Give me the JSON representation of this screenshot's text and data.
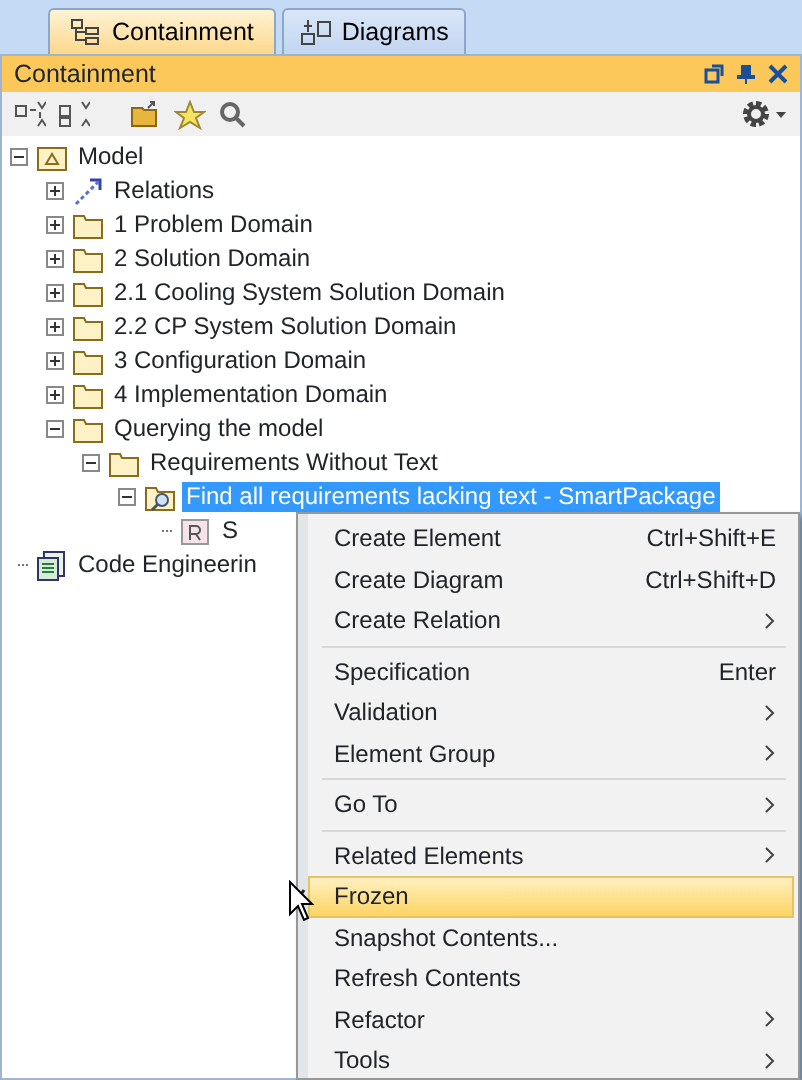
{
  "tabs": [
    {
      "label": "Containment",
      "selected": true
    },
    {
      "label": "Diagrams",
      "selected": false
    }
  ],
  "panel": {
    "title": "Containment"
  },
  "tree": [
    {
      "label": "Model",
      "kind": "model",
      "expanded": true,
      "selected": false,
      "children": [
        {
          "label": "Relations",
          "kind": "relations",
          "expanded": false,
          "selected": false
        },
        {
          "label": "1 Problem Domain",
          "kind": "package",
          "expanded": false,
          "selected": false
        },
        {
          "label": "2 Solution Domain",
          "kind": "package",
          "expanded": false,
          "selected": false
        },
        {
          "label": "2.1 Cooling System Solution Domain",
          "kind": "package",
          "expanded": false,
          "selected": false
        },
        {
          "label": "2.2 CP System Solution Domain",
          "kind": "package",
          "expanded": false,
          "selected": false
        },
        {
          "label": "3 Configuration Domain",
          "kind": "package",
          "expanded": false,
          "selected": false
        },
        {
          "label": "4 Implementation Domain",
          "kind": "package",
          "expanded": false,
          "selected": false
        },
        {
          "label": "Querying the model",
          "kind": "package",
          "expanded": true,
          "selected": false,
          "children": [
            {
              "label": "Requirements Without Text",
              "kind": "package",
              "expanded": true,
              "selected": false,
              "children": [
                {
                  "label": "Find all requirements lacking text - SmartPackage",
                  "kind": "smart",
                  "expanded": true,
                  "selected": true,
                  "children": [
                    {
                      "label": "S",
                      "kind": "requirement",
                      "selected": false
                    }
                  ]
                }
              ]
            }
          ]
        }
      ]
    },
    {
      "label": "Code Engineerin",
      "kind": "code",
      "selected": false
    }
  ],
  "context_menu": [
    [
      {
        "label": "Create Element",
        "shortcut": "Ctrl+Shift+E",
        "submenu": false,
        "checked": false,
        "selected": false
      },
      {
        "label": "Create Diagram",
        "shortcut": "Ctrl+Shift+D",
        "submenu": false,
        "checked": false,
        "selected": false
      },
      {
        "label": "Create Relation",
        "submenu": true,
        "checked": false,
        "selected": false
      }
    ],
    [
      {
        "label": "Specification",
        "shortcut": "Enter",
        "submenu": false,
        "checked": false,
        "selected": false
      },
      {
        "label": "Validation",
        "submenu": true,
        "checked": false,
        "selected": false
      },
      {
        "label": "Element Group",
        "submenu": true,
        "checked": false,
        "selected": false
      }
    ],
    [
      {
        "label": "Go To",
        "submenu": true,
        "checked": false,
        "selected": false
      }
    ],
    [
      {
        "label": "Related Elements",
        "submenu": true,
        "checked": false,
        "selected": false
      },
      {
        "label": "Frozen",
        "submenu": false,
        "checked": true,
        "selected": true
      },
      {
        "label": "Snapshot Contents...",
        "submenu": false,
        "checked": false,
        "selected": false
      },
      {
        "label": "Refresh Contents",
        "submenu": false,
        "checked": false,
        "selected": false
      },
      {
        "label": "Refactor",
        "submenu": true,
        "checked": false,
        "selected": false
      },
      {
        "label": "Tools",
        "submenu": true,
        "checked": false,
        "selected": false
      }
    ]
  ]
}
